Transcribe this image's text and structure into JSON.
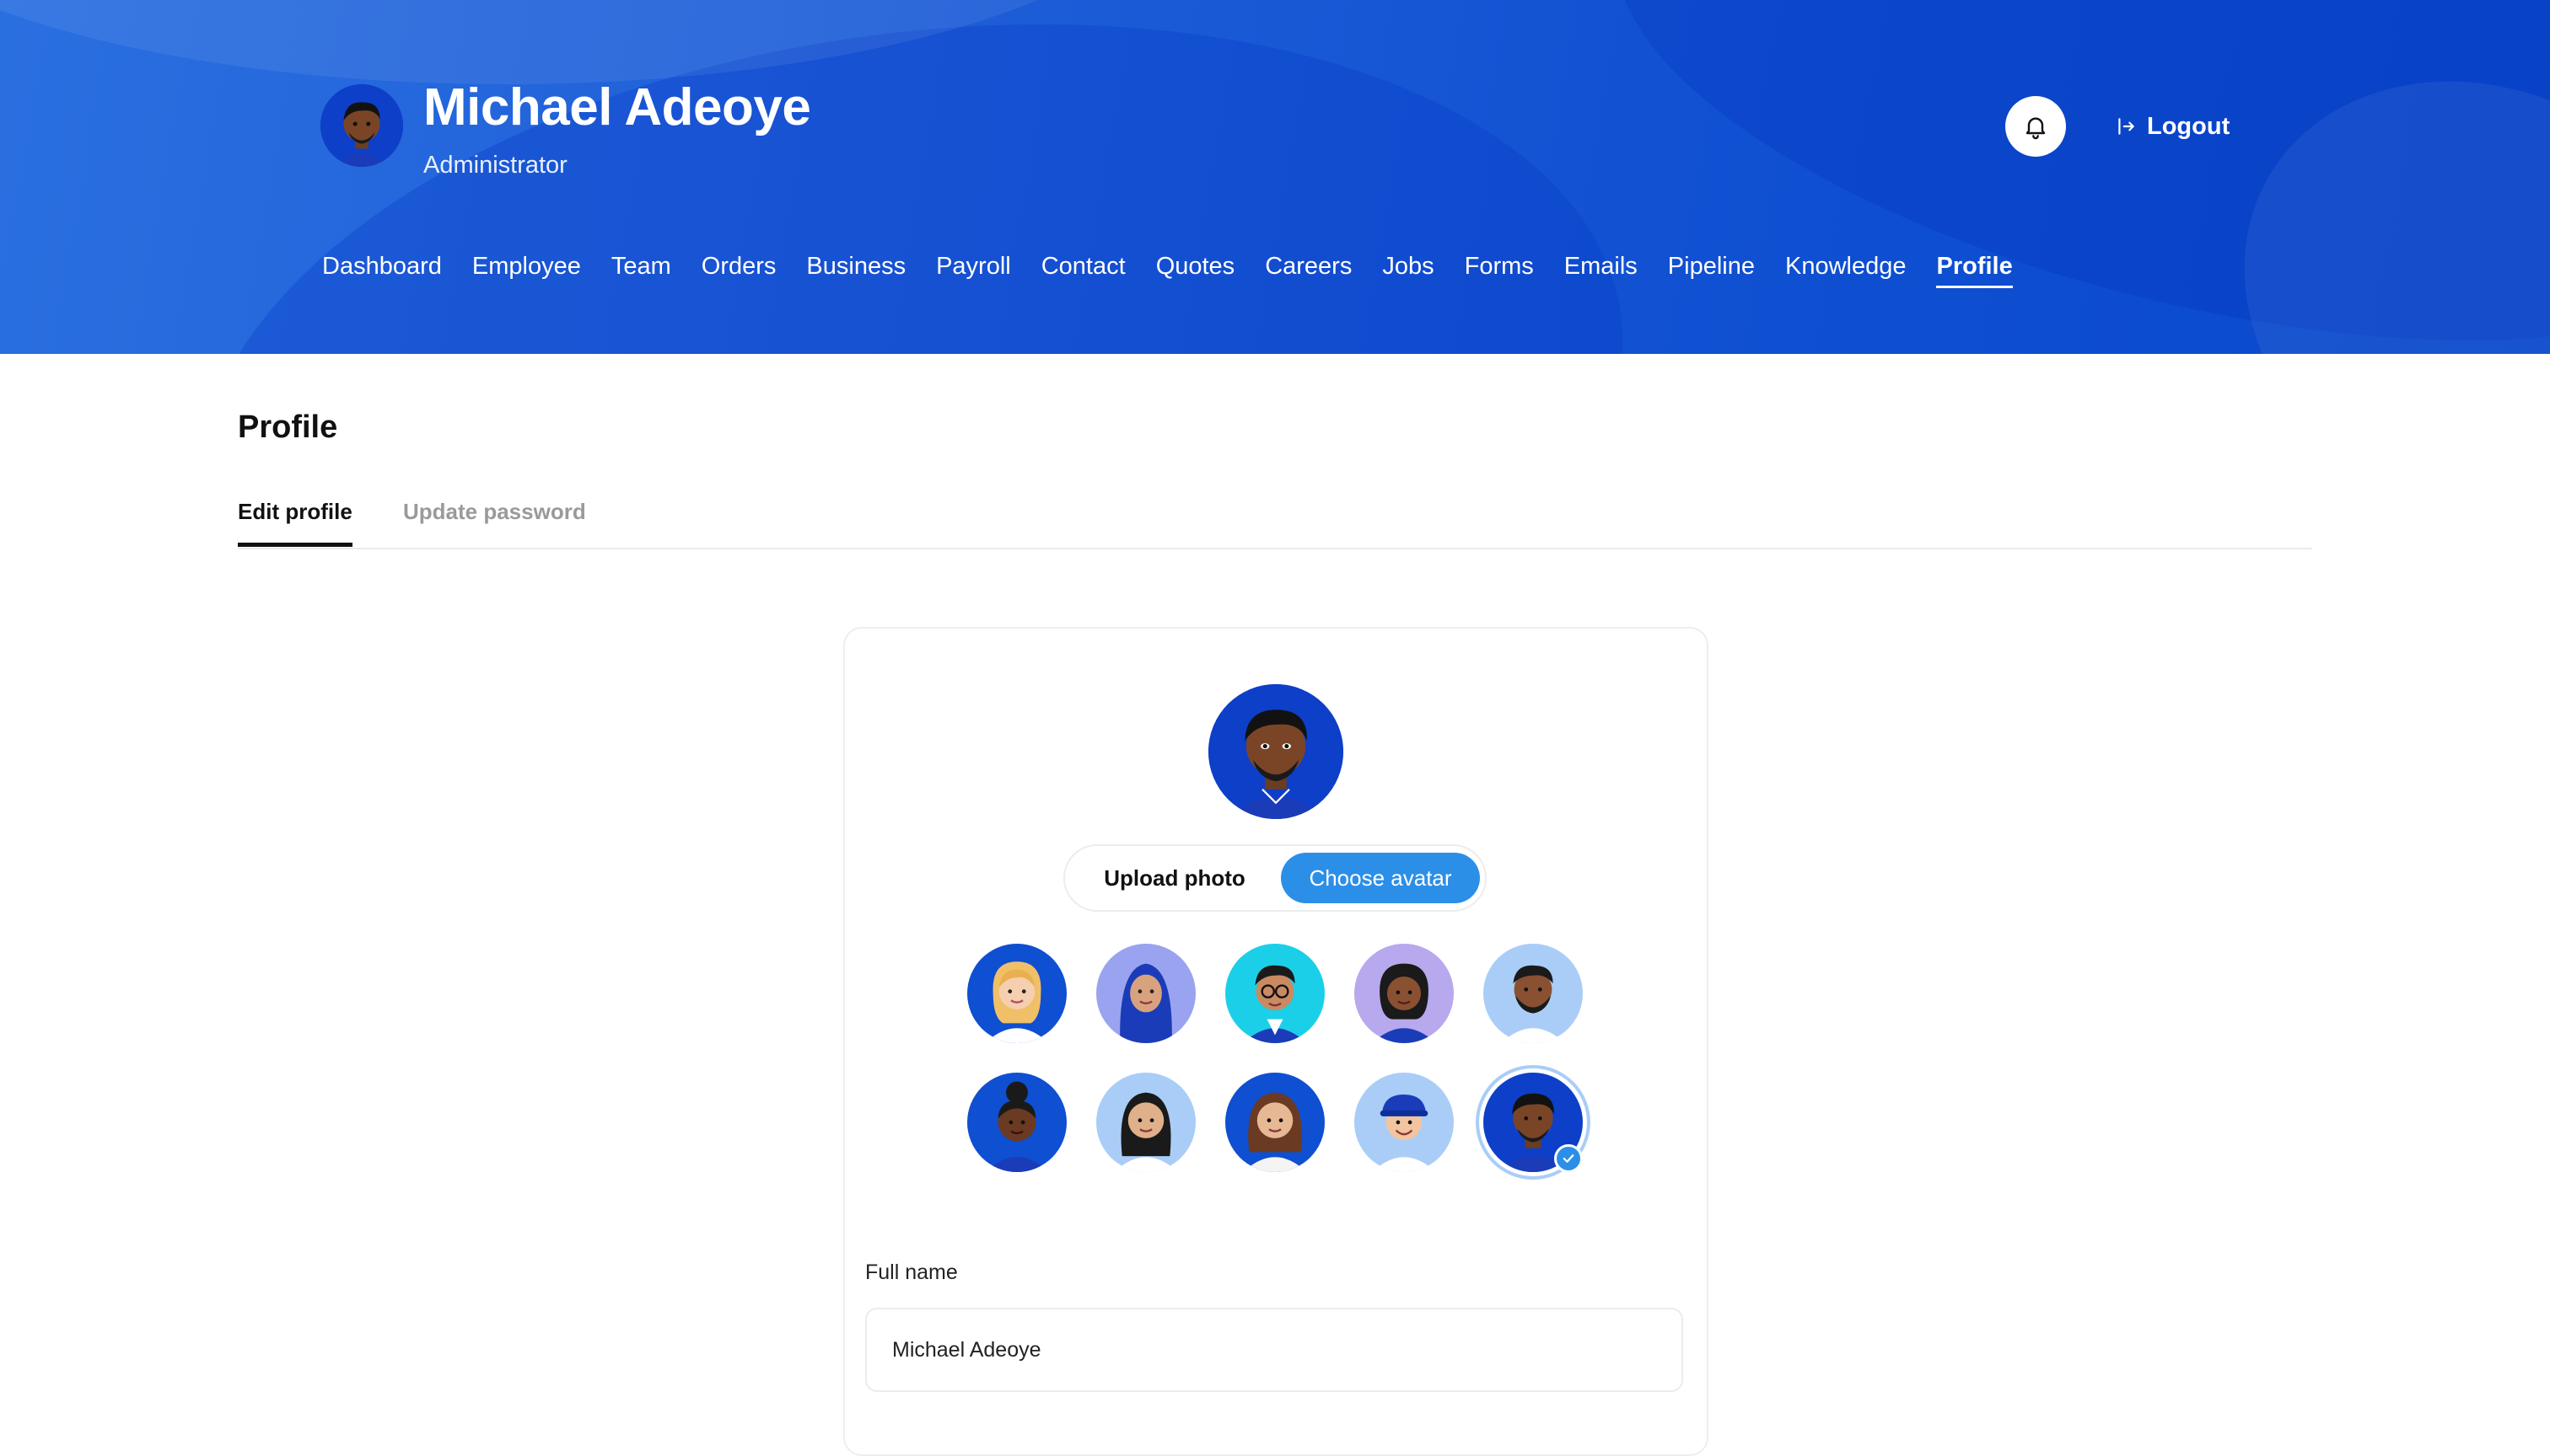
{
  "header": {
    "user_name": "Michael Adeoye",
    "user_role": "Administrator",
    "notifications_icon": "bell-icon",
    "logout_icon": "logout-arrow-icon",
    "logout_label": "Logout",
    "background_color": "#1f5ed8"
  },
  "nav": {
    "items": [
      {
        "label": "Dashboard"
      },
      {
        "label": "Employee"
      },
      {
        "label": "Team"
      },
      {
        "label": "Orders"
      },
      {
        "label": "Business"
      },
      {
        "label": "Payroll"
      },
      {
        "label": "Contact"
      },
      {
        "label": "Quotes"
      },
      {
        "label": "Careers"
      },
      {
        "label": "Jobs"
      },
      {
        "label": "Forms"
      },
      {
        "label": "Emails"
      },
      {
        "label": "Pipeline"
      },
      {
        "label": "Knowledge"
      },
      {
        "label": "Profile"
      }
    ],
    "active": "Profile"
  },
  "page": {
    "title": "Profile",
    "tabs": [
      {
        "label": "Edit profile",
        "active": true
      },
      {
        "label": "Update password",
        "active": false
      }
    ]
  },
  "profile_card": {
    "photo_source_options": [
      {
        "label": "Upload photo",
        "selected": false
      },
      {
        "label": "Choose avatar",
        "selected": true
      }
    ],
    "avatars": [
      {
        "name": "avatar-blonde-woman",
        "selected": false
      },
      {
        "name": "avatar-hijab-woman",
        "selected": false
      },
      {
        "name": "avatar-man-glasses",
        "selected": false
      },
      {
        "name": "avatar-curly-woman",
        "selected": false
      },
      {
        "name": "avatar-bearded-man",
        "selected": false
      },
      {
        "name": "avatar-bun-woman",
        "selected": false
      },
      {
        "name": "avatar-long-hair-woman",
        "selected": false
      },
      {
        "name": "avatar-wavy-hair-woman",
        "selected": false
      },
      {
        "name": "avatar-cap-man",
        "selected": false
      },
      {
        "name": "avatar-hoodie-man",
        "selected": true
      }
    ],
    "full_name_label": "Full name",
    "full_name_value": "Michael Adeoye",
    "accent_color": "#2b8fe8"
  }
}
